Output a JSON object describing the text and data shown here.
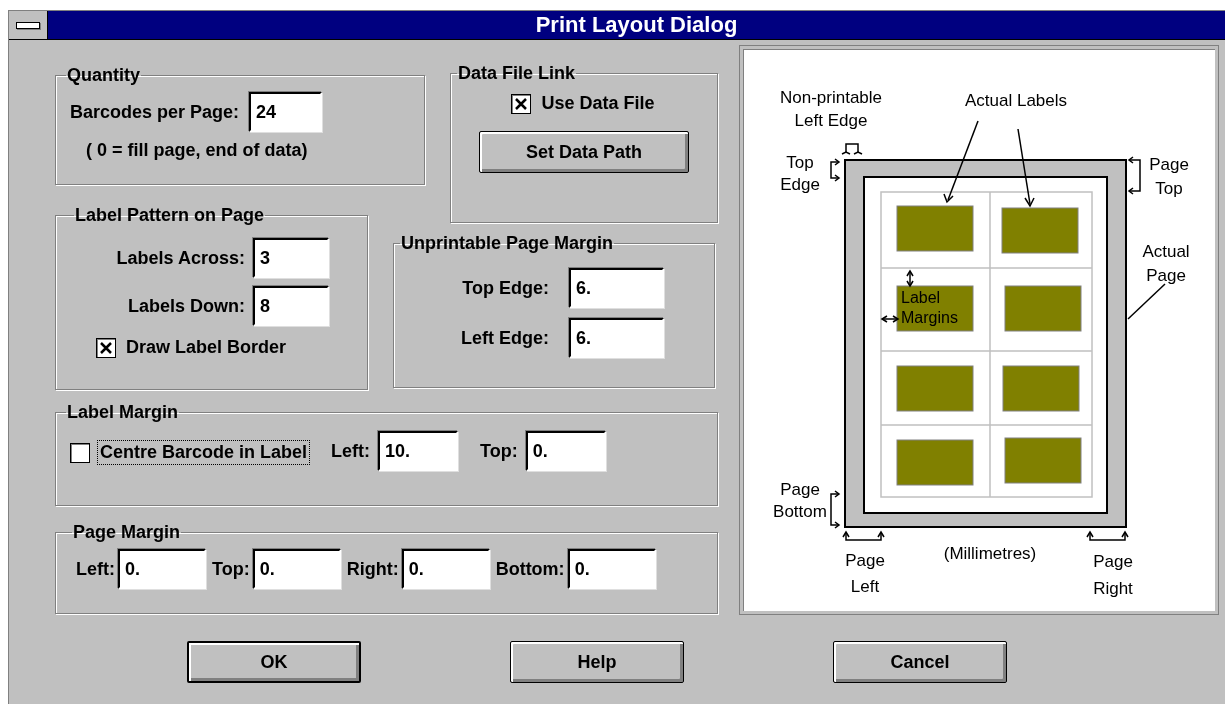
{
  "window": {
    "title": "Print Layout Dialog"
  },
  "quantity": {
    "title": "Quantity",
    "field": {
      "label": "Barcodes per Page:",
      "value": "24"
    },
    "note": "( 0 = fill page, end of data)"
  },
  "data_file_link": {
    "title": "Data File Link",
    "checkbox": {
      "label": "Use Data File",
      "checked": true,
      "focused": false
    },
    "button": "Set Data Path"
  },
  "label_pattern": {
    "title": "Label Pattern on Page",
    "fields": [
      {
        "label": "Labels Across:",
        "value": "3"
      },
      {
        "label": "Labels Down:",
        "value": "8"
      }
    ],
    "checkbox": {
      "label": "Draw Label Border",
      "checked": true,
      "focused": false
    }
  },
  "unprintable_margin": {
    "title": "Unprintable Page Margin",
    "fields": [
      {
        "label": "Top Edge:",
        "value": "6."
      },
      {
        "label": "Left Edge:",
        "value": "6."
      }
    ]
  },
  "label_margin": {
    "title": "Label Margin",
    "checkbox": {
      "label": "Centre Barcode in Label",
      "checked": false,
      "focused": true
    },
    "fields": [
      {
        "label": "Left:",
        "value": "10."
      },
      {
        "label": "Top:",
        "value": "0."
      }
    ]
  },
  "page_margin": {
    "title": "Page Margin",
    "fields": [
      {
        "label": "Left:",
        "value": "0."
      },
      {
        "label": "Top:",
        "value": "0."
      },
      {
        "label": "Right:",
        "value": "0."
      },
      {
        "label": "Bottom:",
        "value": "0."
      }
    ]
  },
  "diagram": {
    "annotations": [
      {
        "lines": [
          "Non-printable",
          "Left Edge"
        ]
      },
      {
        "lines": [
          "Actual Labels"
        ]
      },
      {
        "lines": [
          "Top",
          "Edge"
        ]
      },
      {
        "lines": [
          "Page",
          "Top"
        ]
      },
      {
        "lines": [
          "Actual",
          "Page"
        ]
      },
      {
        "lines": [
          "Page",
          "Bottom"
        ]
      },
      {
        "lines": [
          "Page",
          "Left"
        ]
      },
      {
        "lines": [
          "(Millimetres)"
        ]
      },
      {
        "lines": [
          "Page",
          "Right"
        ]
      }
    ],
    "label_text": [
      "Label",
      "Margins"
    ]
  },
  "buttons": [
    {
      "label": "OK",
      "default": true
    },
    {
      "label": "Help",
      "default": false
    },
    {
      "label": "Cancel",
      "default": false
    }
  ]
}
